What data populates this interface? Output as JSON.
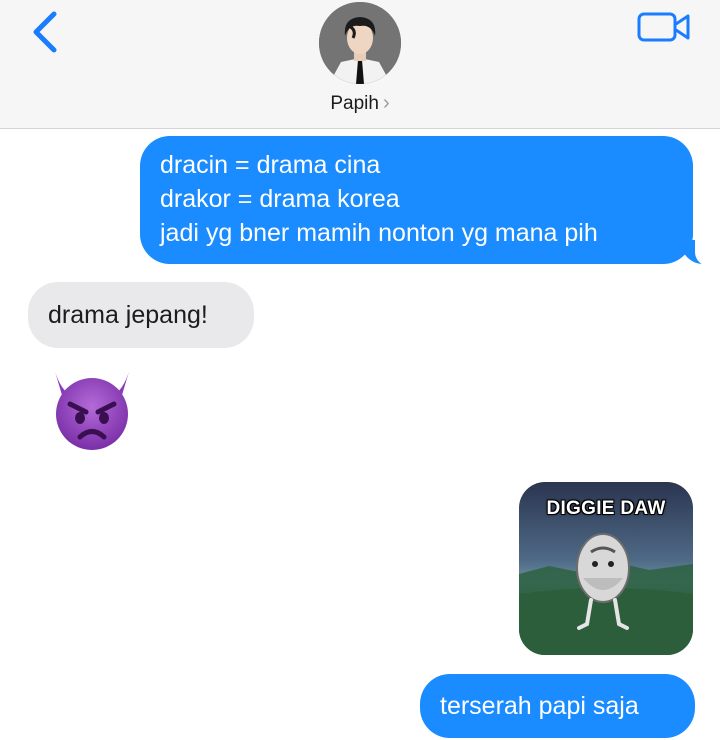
{
  "header": {
    "contact_name": "Papih",
    "chevron": "›",
    "back_icon": "chevron-left-icon",
    "video_icon": "video-camera-icon",
    "accent_color": "#1a7cff"
  },
  "messages": [
    {
      "direction": "sent",
      "lines": [
        "dracin = drama cina",
        "drakor = drama korea",
        "jadi yg bner mamih nonton yg mana pih"
      ]
    },
    {
      "direction": "received",
      "lines": [
        "drama jepang!"
      ]
    },
    {
      "direction": "received",
      "type": "emoji",
      "emoji": "angry-devil-face"
    },
    {
      "direction": "sent",
      "type": "sticker",
      "sticker_text": "DIGGIE DAW"
    },
    {
      "direction": "sent",
      "lines": [
        "terserah papi saja"
      ]
    }
  ],
  "colors": {
    "sent_bubble": "#1a8cff",
    "received_bubble": "#e9e9eb",
    "header_bg": "#f6f6f7"
  }
}
